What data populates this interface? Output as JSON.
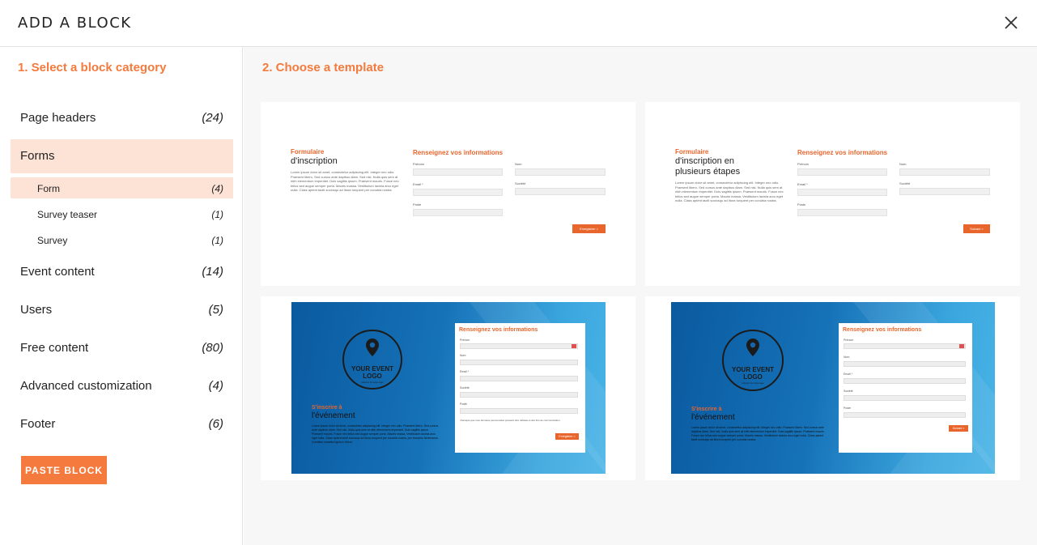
{
  "modal": {
    "title": "ADD A BLOCK",
    "close_icon": "close-icon"
  },
  "categories_panel": {
    "step_title": "1. Select a block category",
    "items": [
      {
        "label": "Page headers",
        "count": "(24)"
      },
      {
        "label": "Forms",
        "count": ""
      },
      {
        "label": "Form",
        "count": "(4)"
      },
      {
        "label": "Survey teaser",
        "count": "(1)"
      },
      {
        "label": "Survey",
        "count": "(1)"
      },
      {
        "label": "Event content",
        "count": "(14)"
      },
      {
        "label": "Users",
        "count": "(5)"
      },
      {
        "label": "Free content",
        "count": "(80)"
      },
      {
        "label": "Advanced customization",
        "count": "(4)"
      },
      {
        "label": "Footer",
        "count": "(6)"
      }
    ],
    "paste_button": "PASTE BLOCK"
  },
  "templates_panel": {
    "step_title": "2. Choose a template",
    "templates": [
      {
        "heading": "Formulaire",
        "subheading": "d'inscription",
        "lorem": "Lorem ipsum dolor sit amet, consectetur adipiscing elit. Integer nec odio. Praesent libero. Sed cursus ante dapibus diam. Sed nisi. Nulla quis sem at nibh elementum imperdiet. Duis sagittis ipsum. Praesent mauris. Fusce nec tellus sed augue semper porta. Mauris massa. Vestibulum lacinia arcu eget nulla. Class aptent taciti sociosqu ad litora torquent per conubia nostra.",
        "form_title": "Renseignez vos informations",
        "labels": [
          "Prénom",
          "Nom",
          "Email *",
          "Société",
          "Poste"
        ],
        "button": "Enregistrer >"
      },
      {
        "heading": "Formulaire",
        "subheading": "d'inscription en plusieurs étapes",
        "lorem": "Lorem ipsum dolor sit amet, consectetur adipiscing elit. Integer nec odio. Praesent libero. Sed cursus ante dapibus diam. Sed nisi. Nulla quis sem at nibh elementum imperdiet. Duis sagittis ipsum. Praesent mauris. Fusce nec tellus sed augue semper porta. Mauris massa. Vestibulum lacinia arcu eget nulla. Class aptent taciti sociosqu ad litora torquent per conubia nostra.",
        "form_title": "Renseignez vos informations",
        "labels": [
          "Prénom",
          "Nom",
          "Email *",
          "Société",
          "Poste"
        ],
        "button": "Suivant >"
      },
      {
        "logo": "YOUR EVENT LOGO",
        "logo_tagline": "Insérez ici votre logo",
        "heading": "S'inscrire à",
        "subheading": "l'événement",
        "lorem": "Lorem ipsum dolor sit amet, consectetur adipiscing elit. Integer nec odio. Praesent libero. Sed cursus ante dapibus diam. Sed nisi. Nulla quis sem at nibh elementum imperdiet. Duis sagittis ipsum. Praesent mauris. Fusce nec tellus sed augue semper porta. Mauris massa. Vestibulum lacinia arcu eget nulla. Class aptent taciti sociosqu ad litora torquent per conubia nostra, per inceptos himenaeos. Curabitur sodales ligula in libero.",
        "form_title": "Renseignez vos informations",
        "labels": [
          "Prénom",
          "Nom",
          "Email *",
          "Société",
          "Poste"
        ],
        "consent": "J'accepte que mes données personnelles puissent être utilisées à des fins de communication.",
        "button": "Enregistrer >"
      },
      {
        "logo": "YOUR EVENT LOGO",
        "logo_tagline": "Insérez ici votre logo",
        "heading": "S'inscrire à",
        "subheading": "l'événement",
        "lorem": "Lorem ipsum dolor sit amet, consectetur adipiscing elit. Integer nec odio. Praesent libero. Sed cursus ante dapibus diam. Sed nisi. Nulla quis sem at nibh elementum imperdiet. Duis sagittis ipsum. Praesent mauris. Fusce nec tellus sed augue semper porta. Mauris massa. Vestibulum lacinia arcu eget nulla. Class aptent taciti sociosqu ad litora torquent per conubia nostra.",
        "form_title": "Renseignez vos informations",
        "labels": [
          "Prénom",
          "Nom",
          "Email *",
          "Société",
          "Poste"
        ],
        "button": "Suivant >"
      }
    ]
  },
  "colors": {
    "accent": "#f47a3d",
    "selected_bg": "#fde3d6",
    "blue_dark": "#0a5a9f",
    "blue_light": "#49b4e6"
  }
}
